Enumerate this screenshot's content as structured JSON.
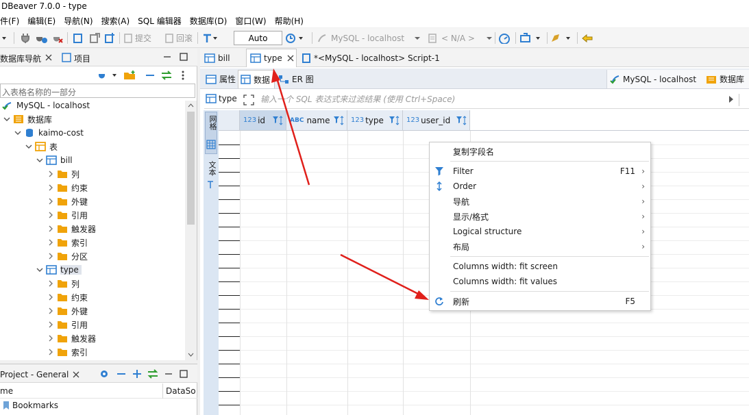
{
  "window": {
    "title": "DBeaver 7.0.0 - type"
  },
  "menubar": {
    "items": [
      "件(F)",
      "编辑(E)",
      "导航(N)",
      "搜索(A)",
      "SQL 编辑器",
      "数据库(D)",
      "窗口(W)",
      "帮助(H)"
    ]
  },
  "toolbar": {
    "commit_label": "提交",
    "rollback_label": "回滚",
    "transaction_mode": "Auto",
    "connection": "MySQL - localhost",
    "schema": "< N/A >"
  },
  "navigator": {
    "tab_label": "数据库导航",
    "projects_tab_label": "项目",
    "filter_placeholder": "入表格名称的一部分",
    "tree": [
      {
        "label": "MySQL - localhost",
        "icon": "connection-icon",
        "expanded": true
      },
      {
        "label": "数据库",
        "icon": "folder-db-icon",
        "expanded": true
      },
      {
        "label": "kaimo-cost",
        "icon": "database-icon",
        "expanded": true
      },
      {
        "label": "表",
        "icon": "tables-folder-icon",
        "expanded": true
      },
      {
        "label": "bill",
        "icon": "table-icon",
        "expanded": true
      },
      {
        "label": "列",
        "icon": "folder-icon",
        "expanded": false
      },
      {
        "label": "约束",
        "icon": "folder-icon",
        "expanded": false
      },
      {
        "label": "外键",
        "icon": "folder-icon",
        "expanded": false
      },
      {
        "label": "引用",
        "icon": "folder-icon",
        "expanded": false
      },
      {
        "label": "触发器",
        "icon": "folder-icon",
        "expanded": false
      },
      {
        "label": "索引",
        "icon": "folder-icon",
        "expanded": false
      },
      {
        "label": "分区",
        "icon": "folder-icon",
        "expanded": false
      },
      {
        "label": "type",
        "icon": "table-icon",
        "expanded": true
      },
      {
        "label": "列",
        "icon": "folder-icon",
        "expanded": false
      },
      {
        "label": "约束",
        "icon": "folder-icon",
        "expanded": false
      },
      {
        "label": "外键",
        "icon": "folder-icon",
        "expanded": false
      },
      {
        "label": "引用",
        "icon": "folder-icon",
        "expanded": false
      },
      {
        "label": "触发器",
        "icon": "folder-icon",
        "expanded": false
      },
      {
        "label": "索引",
        "icon": "folder-icon",
        "expanded": false
      }
    ]
  },
  "project": {
    "tab_label": "Project - General",
    "columns": [
      "me",
      "DataSo"
    ],
    "items": [
      "Bookmarks"
    ]
  },
  "editor": {
    "tabs": [
      {
        "label": "bill",
        "active": false
      },
      {
        "label": "type",
        "active": true
      },
      {
        "label": "*<MySQL - localhost> Script-1",
        "active": false
      }
    ],
    "subtabs": [
      "属性",
      "数据",
      "ER 图"
    ],
    "connection_label": "MySQL - localhost",
    "database_label": "数据库",
    "filter_table": "type",
    "filter_placeholder": "输入一个 SQL 表达式来过滤结果 (使用 Ctrl+Space)",
    "side_labels": [
      "网格",
      "文本"
    ],
    "columns": [
      {
        "type": "123",
        "name": "id"
      },
      {
        "type": "ABC",
        "name": "name"
      },
      {
        "type": "123",
        "name": "type"
      },
      {
        "type": "123",
        "name": "user_id"
      }
    ]
  },
  "context_menu": {
    "items": [
      {
        "label": "复制字段名",
        "shortcut": "",
        "submenu": false,
        "icon": ""
      },
      {
        "label": "Filter",
        "shortcut": "F11",
        "submenu": true,
        "icon": "filter-icon"
      },
      {
        "label": "Order",
        "shortcut": "",
        "submenu": true,
        "icon": "sort-icon"
      },
      {
        "label": "导航",
        "shortcut": "",
        "submenu": true,
        "icon": ""
      },
      {
        "label": "显示/格式",
        "shortcut": "",
        "submenu": true,
        "icon": ""
      },
      {
        "label": "Logical structure",
        "shortcut": "",
        "submenu": true,
        "icon": ""
      },
      {
        "label": "布局",
        "shortcut": "",
        "submenu": true,
        "icon": ""
      },
      {
        "label": "Columns width: fit screen",
        "shortcut": "",
        "submenu": false,
        "icon": ""
      },
      {
        "label": "Columns width: fit values",
        "shortcut": "",
        "submenu": false,
        "icon": ""
      },
      {
        "label": "刷新",
        "shortcut": "F5",
        "submenu": false,
        "icon": "refresh-icon"
      }
    ]
  },
  "colors": {
    "accent": "#2b73c4",
    "annotation_arrow": "#e0201b",
    "folder": "#f0a30a",
    "table": "#2f7fd1"
  }
}
